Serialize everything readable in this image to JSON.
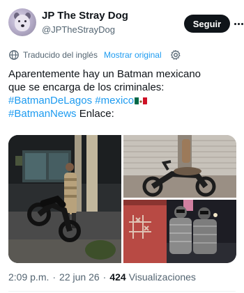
{
  "author": {
    "display_name": "JP The Stray Dog",
    "handle": "@JPTheStrayDog"
  },
  "actions": {
    "follow_label": "Seguir",
    "more_icon": "more-horizontal-icon"
  },
  "translation": {
    "label": "Traducido del inglés",
    "show_original": "Mostrar original",
    "icons": [
      "globe-icon",
      "settings-icon"
    ]
  },
  "tweet": {
    "line1": "Aparentemente hay un Batman mexicano",
    "line2": "que se encarga de los criminales:",
    "hashtag1": "#BatmanDeLagos",
    "hashtag2": "#mexico",
    "hashtag3": "#BatmanNews",
    "trailing_text": " Enlace:",
    "flag": "mexico-flag"
  },
  "media": {
    "images": [
      "man-taped-to-pole-with-motorcycle",
      "motorcycle-parked-by-shutter",
      "taped-men-with-wall-markings"
    ]
  },
  "meta": {
    "time": "2:09 p.m.",
    "separator": "·",
    "date": "22 jun 26",
    "views_count": "424",
    "views_label": "Visualizaciones"
  },
  "colors": {
    "accent": "#1d9bf0",
    "text_primary": "#0f1419",
    "text_secondary": "#536471",
    "follow_bg": "#0f1419"
  }
}
